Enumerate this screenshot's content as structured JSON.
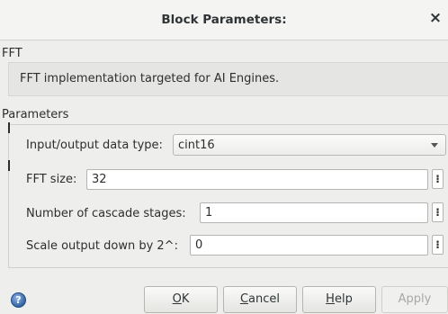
{
  "window": {
    "title": "Block Parameters:",
    "close_glyph": "×"
  },
  "block": {
    "name": "FFT",
    "description": "FFT implementation targeted for AI Engines."
  },
  "parameters": {
    "section_label": "Parameters",
    "data_type": {
      "label": "Input/output data type:",
      "value": "cint16"
    },
    "fft_size": {
      "label": "FFT size:",
      "value": "32"
    },
    "cascade_stages": {
      "label": "Number of cascade stages:",
      "value": "1"
    },
    "scale_output": {
      "label": "Scale output down by 2^:",
      "value": "0"
    },
    "menu_glyph": "⁝"
  },
  "buttons": {
    "help_icon": {
      "icon": "help-icon",
      "glyph": "?"
    },
    "ok": {
      "mnemonic": "O",
      "rest": "K"
    },
    "cancel": {
      "mnemonic": "C",
      "rest": "ancel"
    },
    "help": {
      "mnemonic": "H",
      "rest": "elp"
    },
    "apply": {
      "label": "Apply",
      "disabled": true
    }
  }
}
